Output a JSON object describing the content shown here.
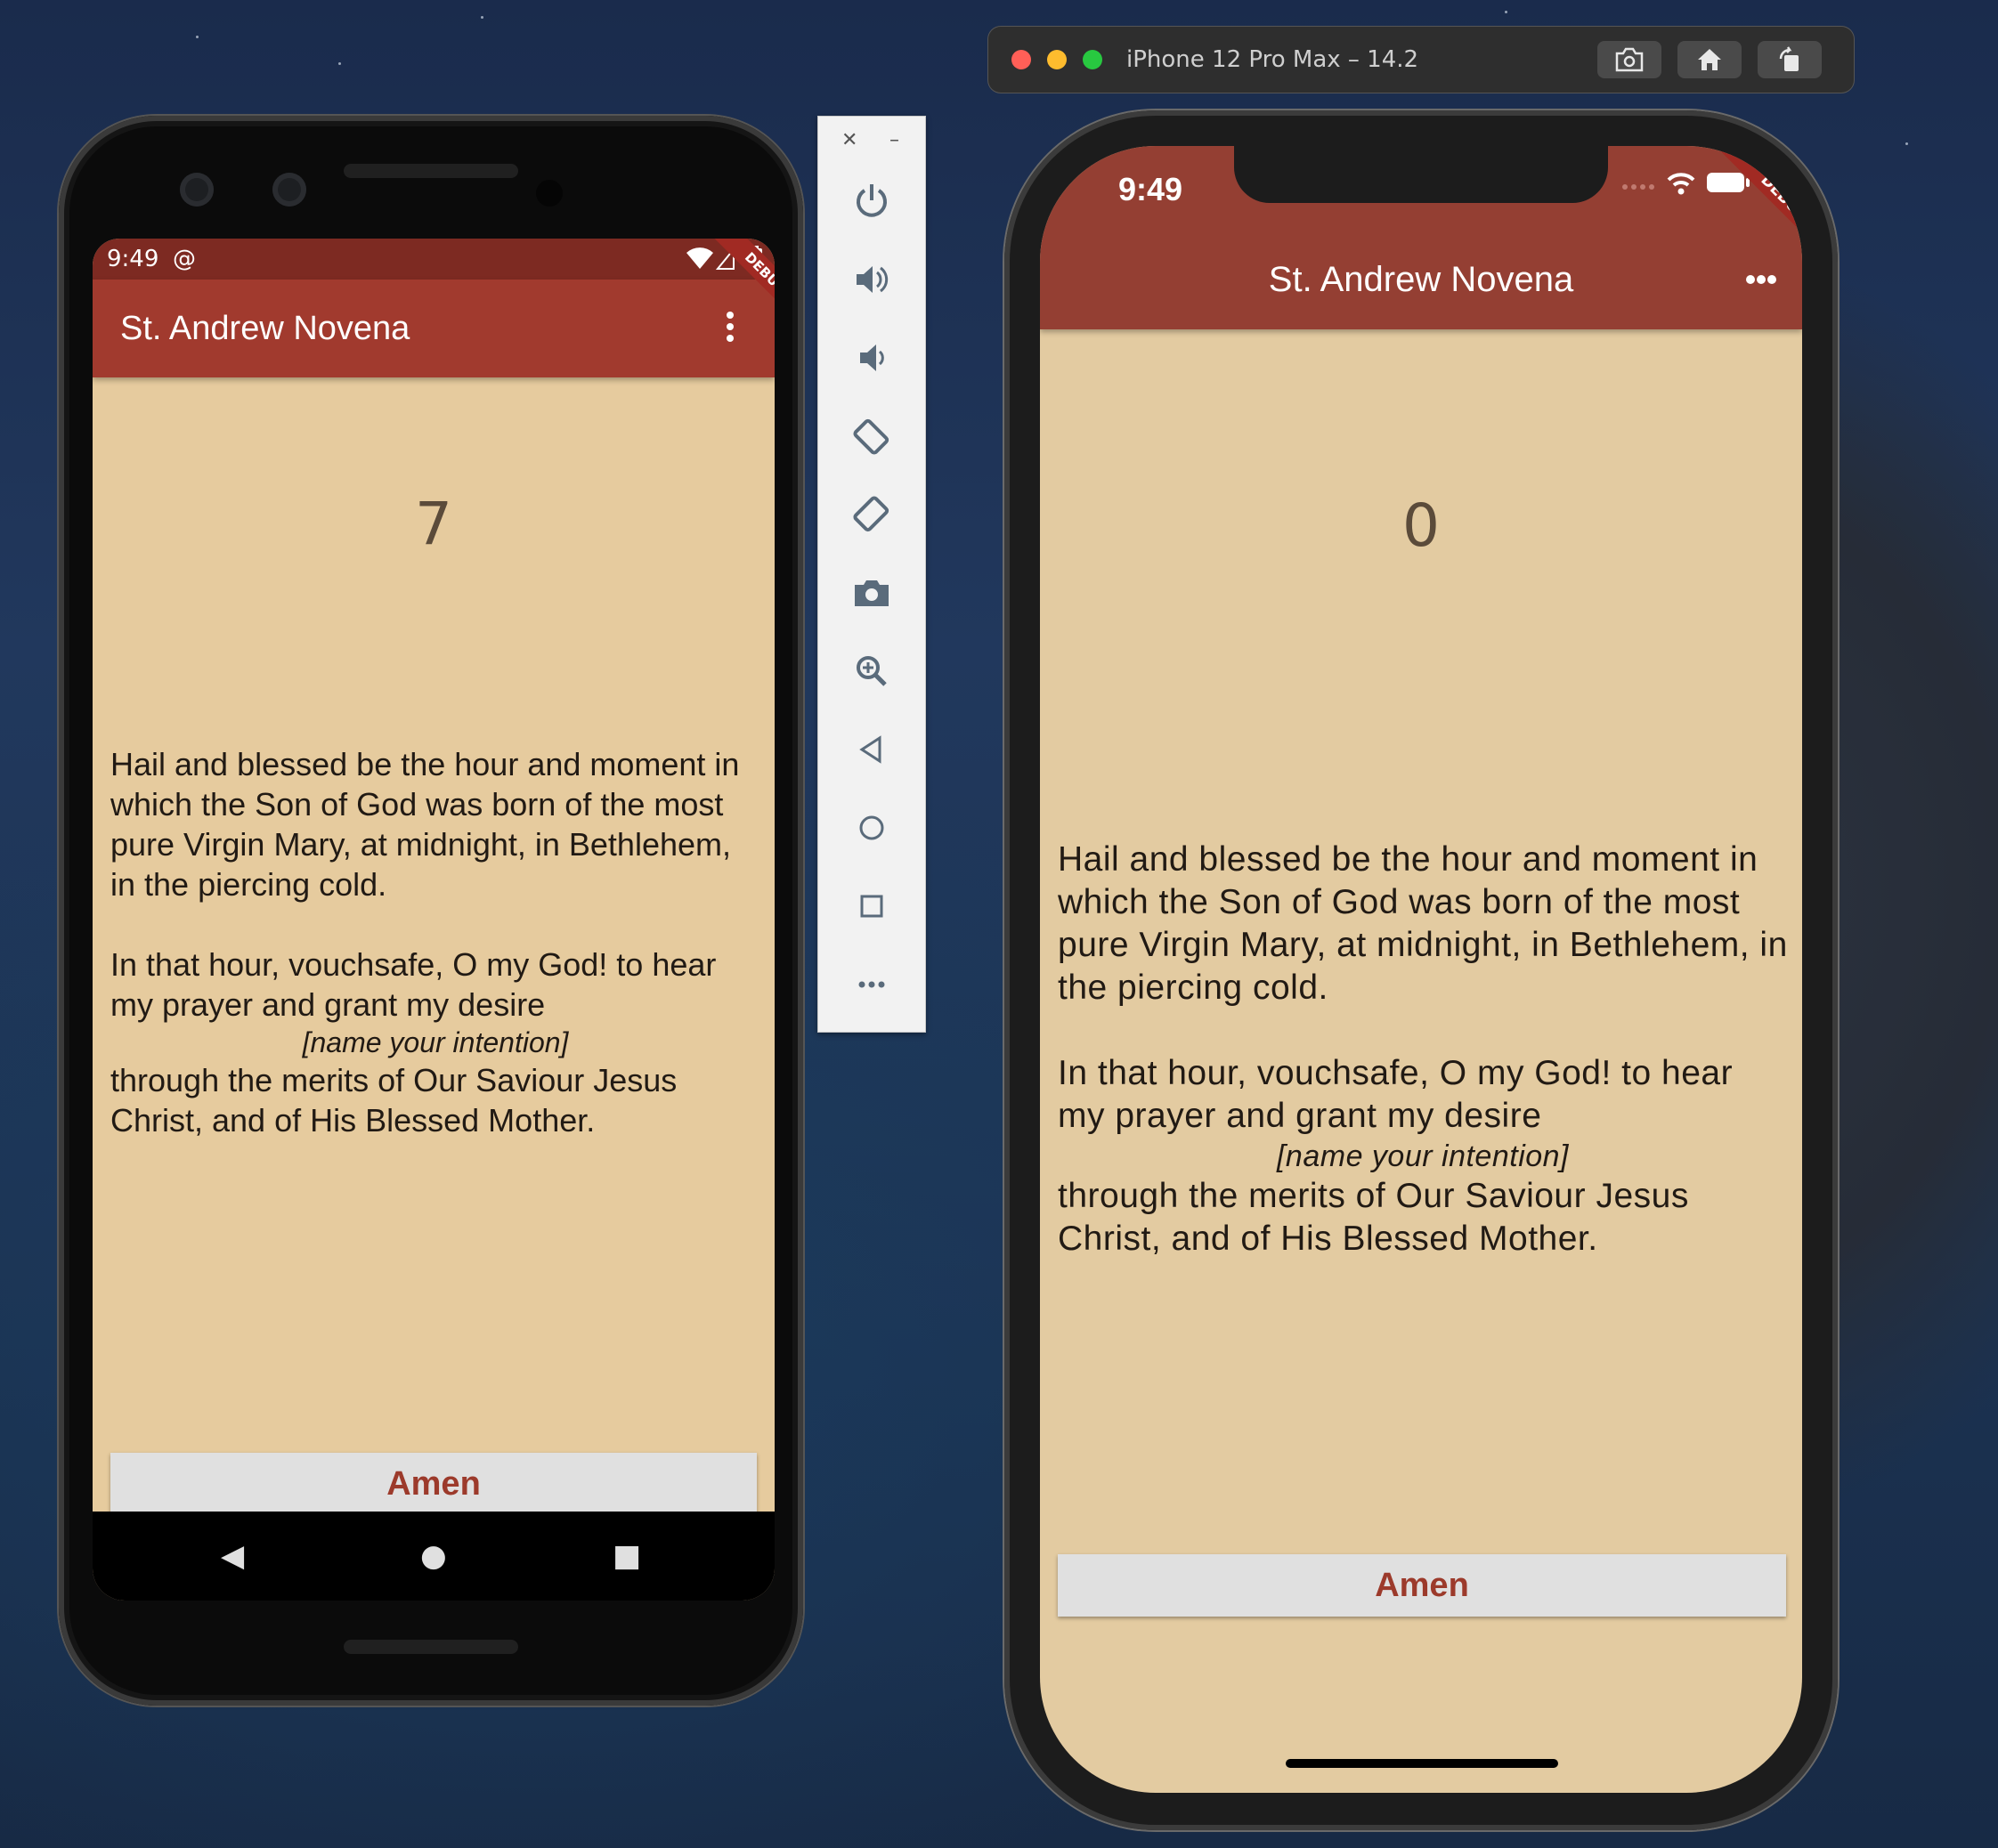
{
  "android": {
    "status_time": "9:49",
    "app_title": "St. Andrew Novena",
    "debug_label": "DEBUG",
    "counter": "7",
    "prayer": {
      "para1": "Hail and blessed be the hour and moment in which the Son of God was born of the most pure Virgin Mary, at midnight, in Bethlehem, in the piercing cold.",
      "para2": "In that hour, vouchsafe, O my God! to hear my prayer and grant my desire",
      "intention": "[name your intention]",
      "para3": "through the merits of Our Saviour Jesus Christ, and of His Blessed Mother."
    },
    "amen_label": "Amen"
  },
  "emulator_toolbar": {
    "items": [
      "power-icon",
      "volume-up-icon",
      "volume-down-icon",
      "rotate-left-icon",
      "rotate-right-icon",
      "camera-icon",
      "zoom-icon",
      "back-icon",
      "home-icon",
      "overview-icon",
      "more-icon"
    ]
  },
  "simulator": {
    "window_title": "iPhone 12 Pro Max – 14.2",
    "status_time": "9:49",
    "app_title": "St. Andrew Novena",
    "debug_label": "DEBUG",
    "counter": "0",
    "prayer": {
      "para1": "Hail and blessed be the hour and moment in which the Son of God was born of the most pure Virgin Mary, at midnight, in Bethlehem, in the piercing cold.",
      "para2": "In that hour, vouchsafe, O my God! to hear my prayer and grant my desire",
      "intention": "[name your intention]",
      "para3": "through the merits of Our Saviour Jesus Christ, and of His Blessed Mother."
    },
    "amen_label": "Amen"
  },
  "colors": {
    "appbar_android": "#a13a2e",
    "appbar_ios": "#943f33",
    "background": "#e6cb9e",
    "button_text": "#9c3a2b"
  }
}
